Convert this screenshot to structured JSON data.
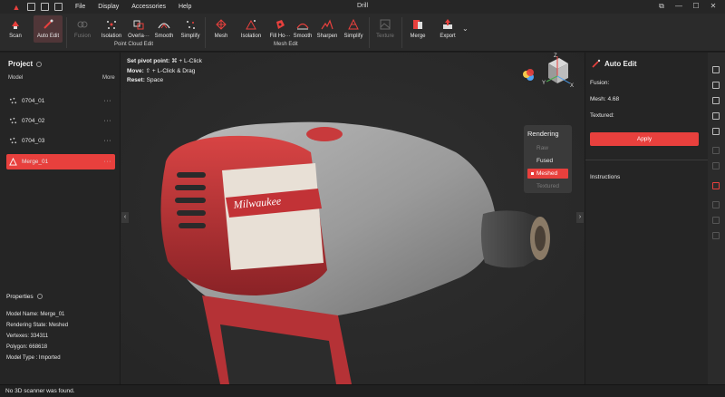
{
  "window": {
    "title": "Drill",
    "menu": [
      "File",
      "Display",
      "Accessories",
      "Help"
    ]
  },
  "toolbar": {
    "scan": "Scan",
    "auto_edit": "Auto Edit",
    "point_cloud": {
      "label": "Point Cloud Edit",
      "fusion": "Fusion",
      "isolation": "Isolation",
      "overlap": "Overla···",
      "smooth": "Smooth",
      "simplify": "Simplify"
    },
    "mesh": {
      "label": "Mesh Edit",
      "mesh": "Mesh",
      "isolation": "Isolation",
      "fill_holes": "Fill Ho···",
      "smooth": "Smooth",
      "sharpen": "Sharpen",
      "simplify": "Simplify"
    },
    "texture": "Texture",
    "merge": "Merge",
    "export": "Export"
  },
  "project": {
    "title": "Project",
    "col_model": "Model",
    "col_more": "More",
    "models": [
      {
        "name": "0704_01"
      },
      {
        "name": "0704_02"
      },
      {
        "name": "0704_03"
      },
      {
        "name": "Merge_01"
      }
    ],
    "more_glyph": "···"
  },
  "properties": {
    "title": "Properties",
    "model_name": "Model Name:  Merge_01",
    "rendering_state": "Rendering State:  Meshed",
    "vertexes": "Vertexes:  334311",
    "polygon": "Polygon:  668618",
    "model_type": "Model Type :  Imported"
  },
  "viewport": {
    "hint_pivot_key": "Set pivot point:",
    "hint_pivot_val": " ⌘ + L-Click",
    "hint_move_key": "Move:",
    "hint_move_val": " ⇧ + L-Click & Drag",
    "hint_reset_key": "Reset:",
    "hint_reset_val": " Space",
    "rendering": {
      "title": "Rendering",
      "raw": "Raw",
      "fused": "Fused",
      "meshed": "Meshed",
      "textured": "Textured"
    },
    "axis_z": "Z",
    "axis_y": "Y",
    "axis_x": "X",
    "brand_text": "Milwaukee"
  },
  "auto_edit": {
    "title": "Auto Edit",
    "fusion": "Fusion:",
    "mesh": "Mesh:   4.68",
    "textured": "Textured:",
    "apply": "Apply",
    "instructions": "Instructions"
  },
  "status": {
    "text": "No 3D scanner was found."
  },
  "colors": {
    "accent": "#e8403d",
    "panel": "#252525",
    "toolbar": "#2b2b2b"
  }
}
